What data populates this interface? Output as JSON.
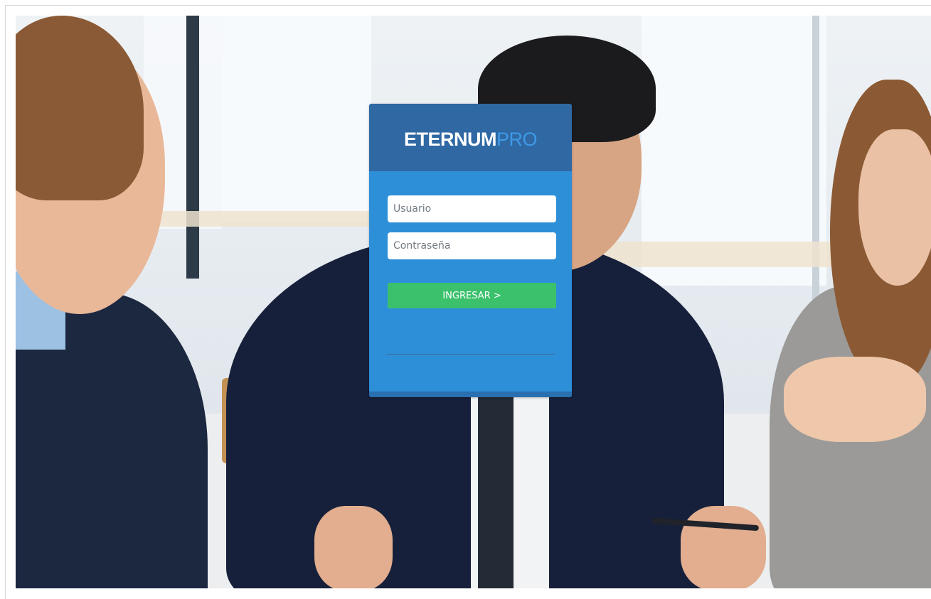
{
  "login": {
    "brand_primary": "ETERNUM",
    "brand_accent": "PRO",
    "username_placeholder": "Usuario",
    "password_placeholder": "Contraseña",
    "submit_label": "INGRESAR >"
  },
  "colors": {
    "header_bg": "#2f68a3",
    "body_bg": "#2e8fd9",
    "brand_accent": "#3f9ae8",
    "submit_bg": "#3bc16c"
  }
}
